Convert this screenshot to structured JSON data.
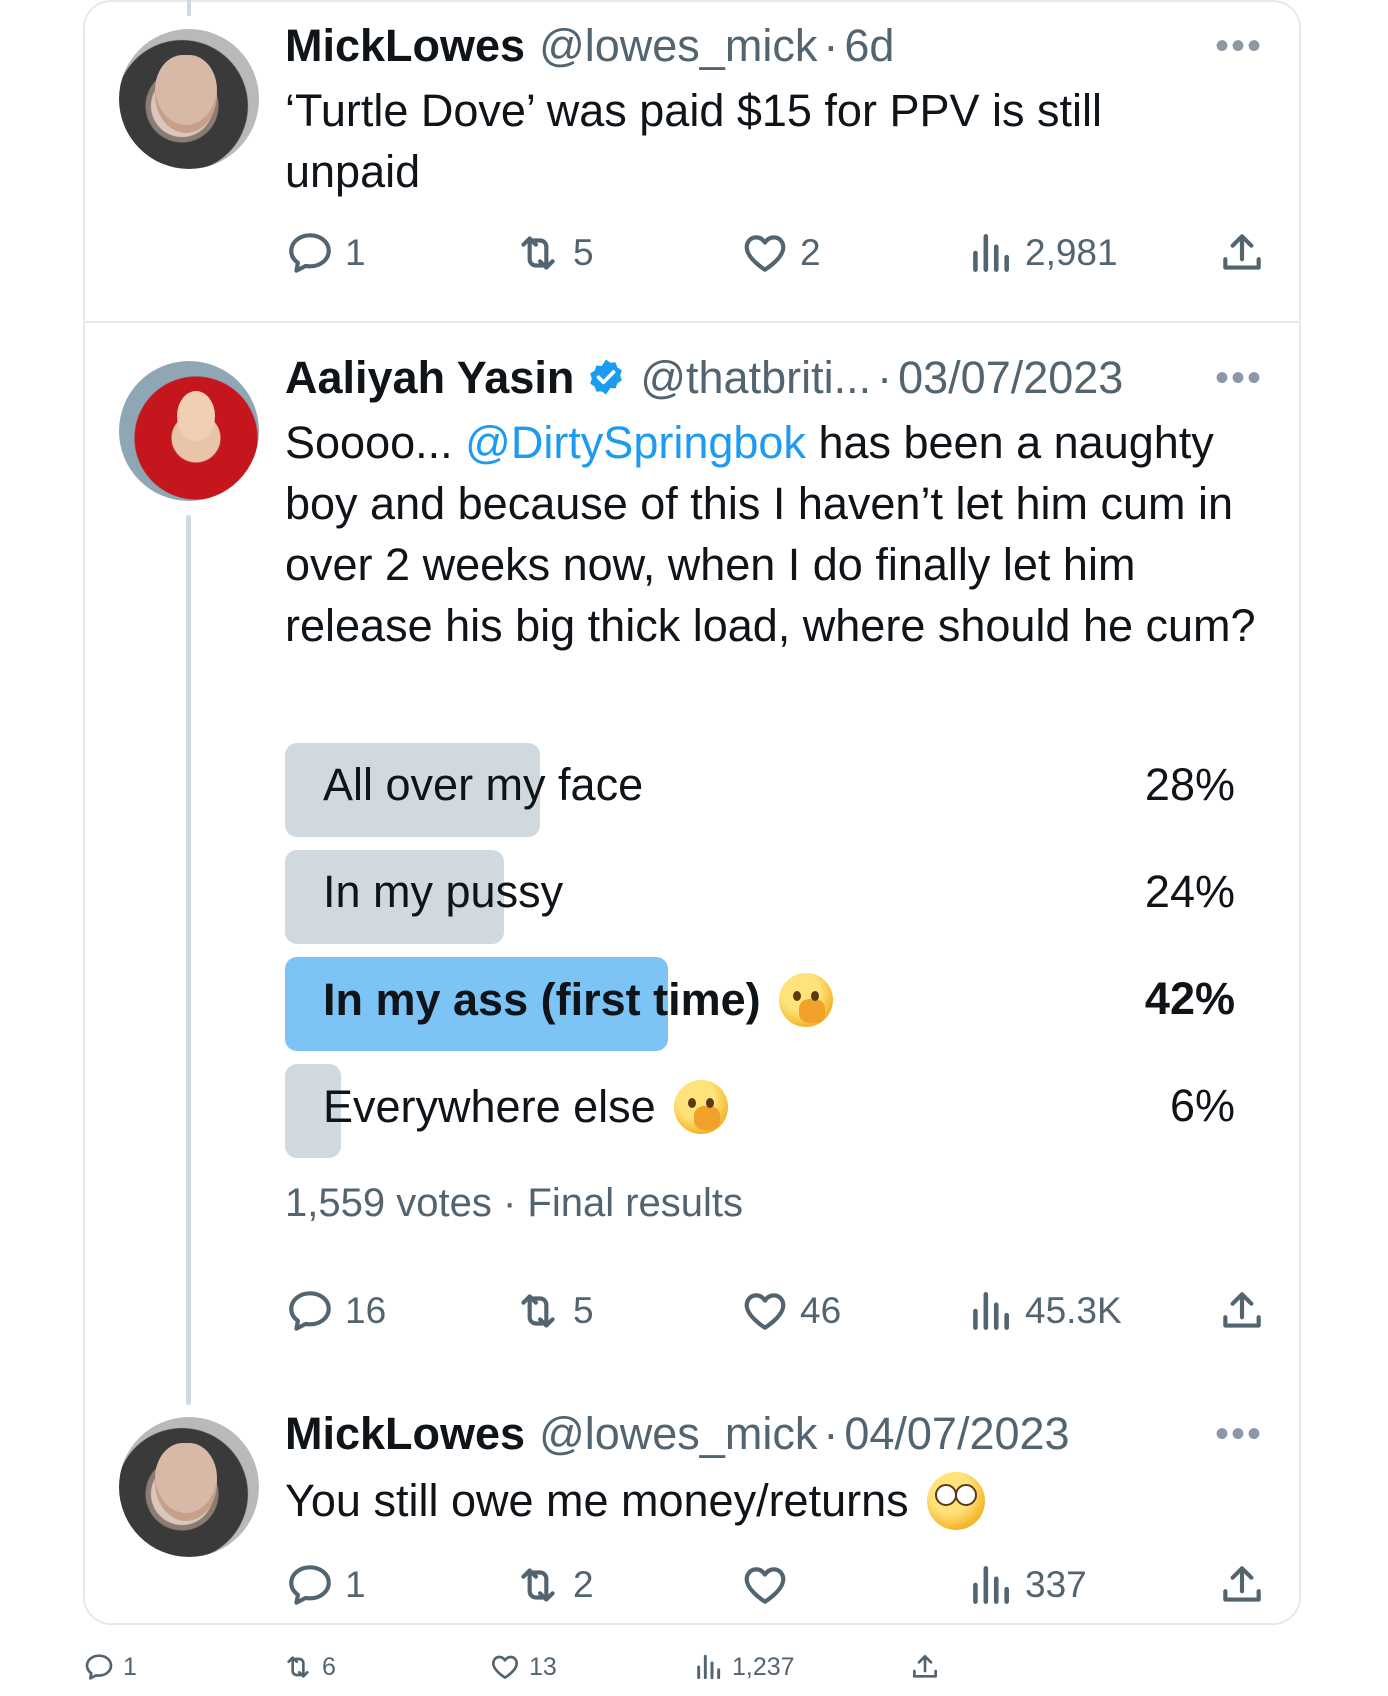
{
  "tweets": [
    {
      "name": "MickLowes",
      "handle": "@lowes_mick",
      "sep": "·",
      "date": "6d",
      "text": "‘Turtle Dove’ was paid $15 for PPV is still unpaid",
      "reply_count": "1",
      "retweet_count": "5",
      "like_count": "2",
      "view_count": "2,981",
      "avatar_icon": "avatar-photo"
    },
    {
      "name": "Aaliyah Yasin",
      "handle": "@thatbriti...",
      "sep": "·",
      "date": "03/07/2023",
      "verified": true,
      "text_before": "Soooo... ",
      "mention": "@DirtySpringbok",
      "text_after": " has been a naughty boy and because of this I haven’t let him cum in over 2 weeks now, when I do finally let him release his big thick load, where should he cum?",
      "poll": {
        "options": [
          {
            "label": "All over my face",
            "percent": "28%",
            "value": 28,
            "winner": false,
            "emoji": ""
          },
          {
            "label": "In my pussy",
            "percent": "24%",
            "value": 24,
            "winner": false,
            "emoji": ""
          },
          {
            "label": "In my ass (first time)",
            "percent": "42%",
            "value": 42,
            "winner": true,
            "emoji": "face-with-hand-over-mouth"
          },
          {
            "label": "Everywhere else",
            "percent": "6%",
            "value": 6,
            "winner": false,
            "emoji": "face-with-hand-over-mouth"
          }
        ],
        "votes": "1,559 votes",
        "sep": "·",
        "status": "Final results"
      },
      "reply_count": "16",
      "retweet_count": "5",
      "like_count": "46",
      "view_count": "45.3K"
    },
    {
      "name": "MickLowes",
      "handle": "@lowes_mick",
      "sep": "·",
      "date": "04/07/2023",
      "text": "You still owe me money/returns",
      "emoji": "face-with-rolling-eyes",
      "reply_count": "1",
      "retweet_count": "2",
      "like_count": "",
      "view_count": "337"
    }
  ],
  "footer": {
    "reply_count": "1",
    "retweet_count": "6",
    "like_count": "13",
    "view_count": "1,237"
  },
  "more_label": "•••",
  "colors": {
    "accent": "#1d9bf0",
    "poll_winner": "#7cc4f5",
    "poll_bar": "#cfd9de",
    "muted_text": "#536471"
  }
}
